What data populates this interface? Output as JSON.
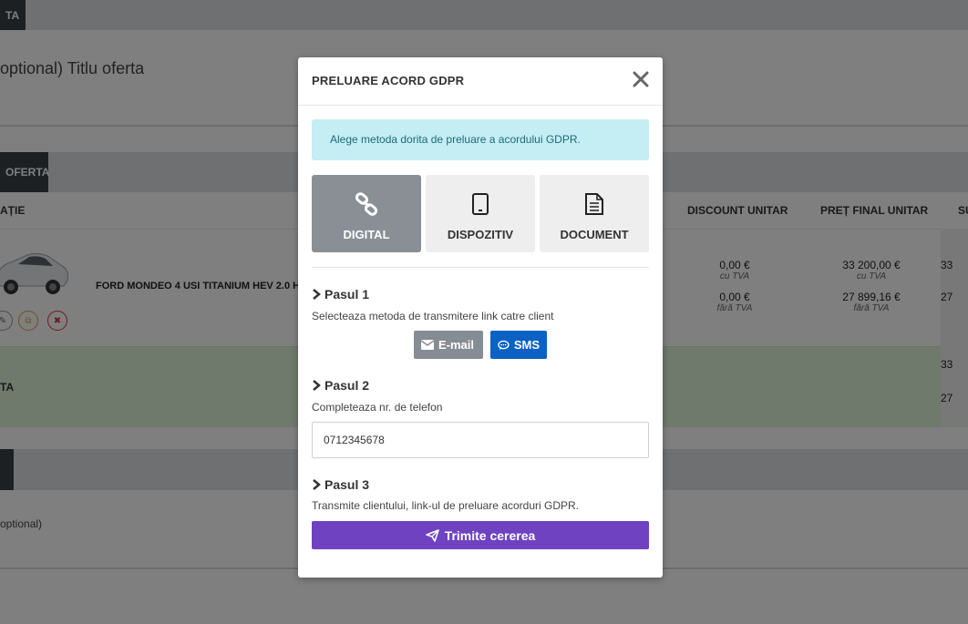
{
  "background": {
    "top_tab": "TA",
    "offer_title": "optional) Titlu oferta",
    "section_tab": "OFERTA",
    "col_config": "AȚIE",
    "col_discount": "DISCOUNT UNITAR",
    "col_final": "PREȚ FINAL UNITAR",
    "col_sum": "SU",
    "car_name": "FORD MONDEO 4 USI TITANIUM HEV 2.0 H",
    "discount_tva": "0,00 €",
    "discount_tva_note": "cu TVA",
    "discount_no_tva": "0,00 €",
    "discount_no_tva_note": "fără TVA",
    "final_tva": "33 200,00 €",
    "final_tva_note": "cu TVA",
    "final_no_tva": "27 899,16 €",
    "final_no_tva_note": "fără TVA",
    "sum_tva": "33",
    "sum_no_tva": "27",
    "total_label": "TA",
    "total_sum_tva": "33",
    "total_sum_no_tva": "27",
    "optional_text": "optional)"
  },
  "modal": {
    "title": "PRELUARE ACORD GDPR",
    "alert": "Alege metoda dorita de preluare a acordului GDPR.",
    "methods": [
      {
        "label": "DIGITAL",
        "icon": "link-icon",
        "active": true
      },
      {
        "label": "DISPOZITIV",
        "icon": "tablet-icon",
        "active": false
      },
      {
        "label": "DOCUMENT",
        "icon": "document-icon",
        "active": false
      }
    ],
    "step1": {
      "title": "Pasul 1",
      "desc": "Selecteaza metoda de transmitere link catre client"
    },
    "email_label": "E-mail",
    "sms_label": "SMS",
    "step2": {
      "title": "Pasul 2",
      "desc": "Completeaza nr. de telefon"
    },
    "phone_value": "0712345678",
    "step3": {
      "title": "Pasul 3",
      "desc": "Transmite clientului, link-ul de preluare acorduri GDPR."
    },
    "send_label": "Trimite cererea"
  },
  "colors": {
    "active_method": "#8a8f96",
    "sms": "#0b62c4",
    "email": "#868c93",
    "send": "#6f42c1",
    "alert_bg": "#c4edf4"
  }
}
